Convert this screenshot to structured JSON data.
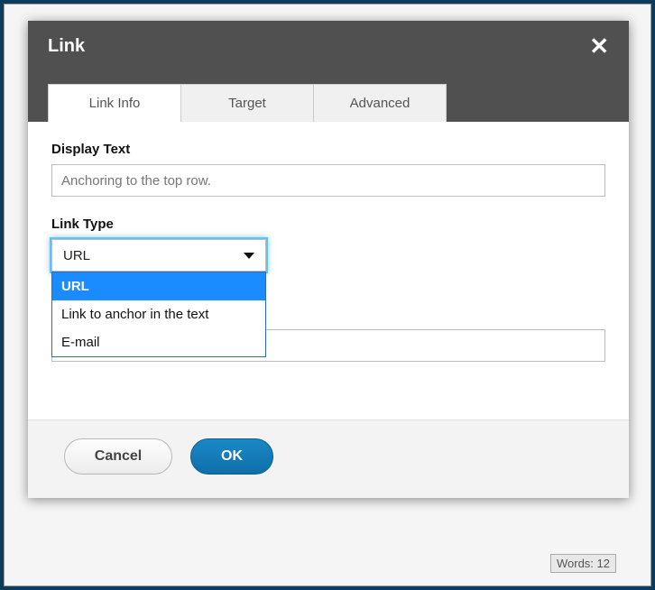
{
  "dialog": {
    "title": "Link",
    "tabs": [
      {
        "label": "Link Info",
        "active": true
      },
      {
        "label": "Target",
        "active": false
      },
      {
        "label": "Advanced",
        "active": false
      }
    ],
    "fields": {
      "display_text": {
        "label": "Display Text",
        "value": "Anchoring to the top row."
      },
      "link_type": {
        "label": "Link Type",
        "selected": "URL",
        "options": [
          "URL",
          "Link to anchor in the text",
          "E-mail"
        ]
      }
    },
    "buttons": {
      "cancel": "Cancel",
      "ok": "OK"
    }
  },
  "status_bar": {
    "words_label": "Words:",
    "words_count": "12"
  }
}
